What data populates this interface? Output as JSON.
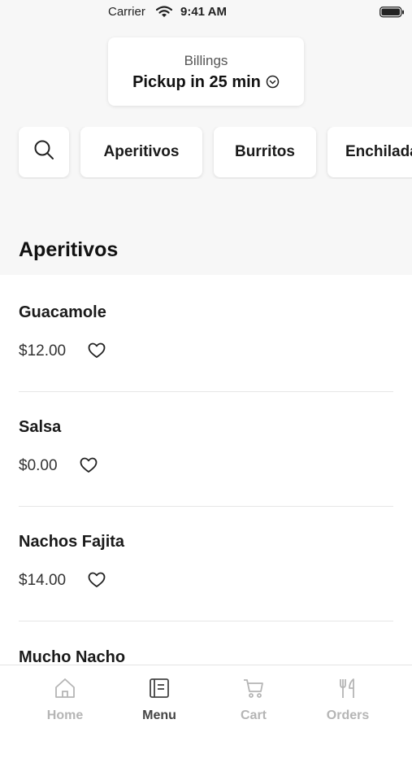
{
  "status_bar": {
    "carrier": "Carrier",
    "time": "9:41 AM"
  },
  "pickup": {
    "location": "Billings",
    "time_text": "Pickup in 25 min"
  },
  "categories": [
    "Aperitivos",
    "Burritos",
    "Enchiladas"
  ],
  "section": {
    "title": "Aperitivos"
  },
  "items": [
    {
      "name": "Guacamole",
      "price": "$12.00"
    },
    {
      "name": "Salsa",
      "price": "$0.00"
    },
    {
      "name": "Nachos Fajita",
      "price": "$14.00"
    },
    {
      "name": "Mucho Nacho",
      "price": ""
    }
  ],
  "tabs": [
    {
      "label": "Home",
      "icon": "home-icon",
      "active": false
    },
    {
      "label": "Menu",
      "icon": "menu-book-icon",
      "active": true
    },
    {
      "label": "Cart",
      "icon": "cart-icon",
      "active": false
    },
    {
      "label": "Orders",
      "icon": "fork-knife-icon",
      "active": false
    }
  ],
  "colors": {
    "active_tab": "#444444",
    "inactive_tab": "#b5b5b5",
    "header_bg": "#f7f7f7"
  }
}
